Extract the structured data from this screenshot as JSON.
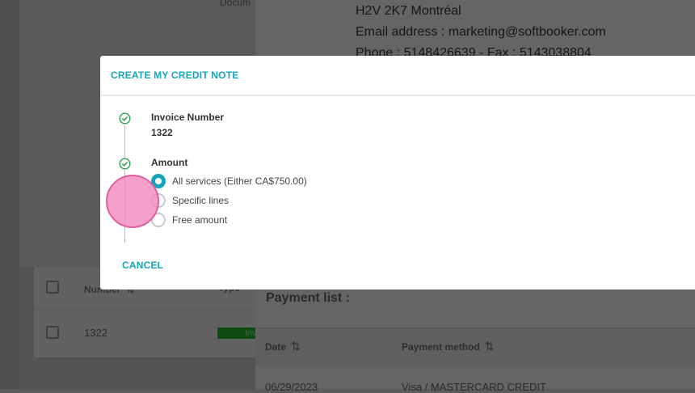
{
  "background": {
    "document_label": "Docum",
    "invoices_table": {
      "headers": [
        "Number",
        "Type"
      ],
      "row": {
        "number": "1322",
        "status": "Inv"
      }
    },
    "company": {
      "address_line": "H2V 2K7 Montréal",
      "email_line": "Email address : marketing@softbooker.com",
      "phone_line": "Phone : 5148426639 - Fax : 5143038804"
    },
    "payments": {
      "title": "Payment list :",
      "headers": [
        "Date",
        "Payment method"
      ],
      "row": {
        "date": "06/29/2023",
        "method": "Visa / MASTERCARD CREDIT"
      }
    }
  },
  "modal": {
    "title": "CREATE MY CREDIT NOTE",
    "steps": [
      {
        "label": "Invoice Number",
        "value": "1322",
        "icon": "check-circle-icon"
      },
      {
        "label": "Amount",
        "icon": "check-circle-icon"
      }
    ],
    "amount_options": [
      {
        "label": "All services (Either CA$750.00)",
        "checked": true
      },
      {
        "label": "Specific lines",
        "checked": false
      },
      {
        "label": "Free amount",
        "checked": false
      }
    ],
    "cancel_label": "CANCEL"
  },
  "colors": {
    "accent": "#14a5b8",
    "step_check": "#2e9e4f",
    "click_marker": "#f387be"
  }
}
